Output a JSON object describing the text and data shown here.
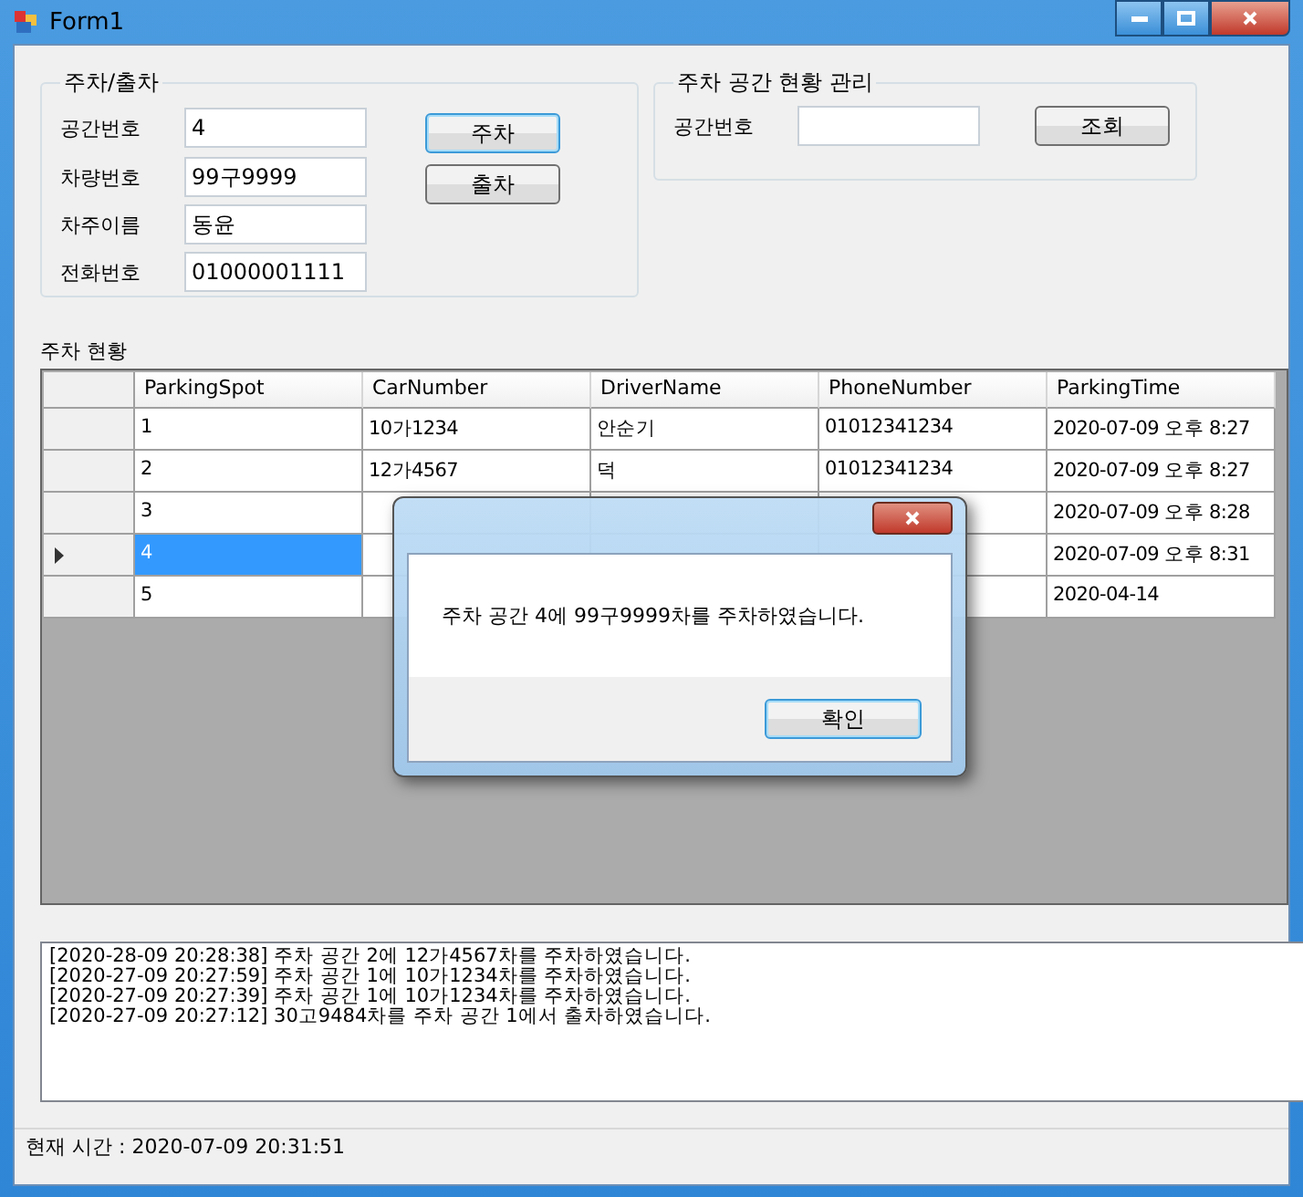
{
  "window": {
    "title": "Form1"
  },
  "parking_group": {
    "title": "주차/출차",
    "fields": [
      {
        "label": "공간번호",
        "value": "4"
      },
      {
        "label": "차량번호",
        "value": "99구9999"
      },
      {
        "label": "차주이름",
        "value": "동윤"
      },
      {
        "label": "전화번호",
        "value": "01000001111"
      }
    ],
    "buttons": [
      {
        "label": "주차",
        "focused": true
      },
      {
        "label": "출차",
        "focused": false
      }
    ]
  },
  "status_group": {
    "title": "주차 공간 현황 관리",
    "field": {
      "label": "공간번호"
    },
    "button": "조회"
  },
  "grid": {
    "title": "주차 현황",
    "columns": [
      "ParkingSpot",
      "CarNumber",
      "DriverName",
      "PhoneNumber",
      "ParkingTime"
    ],
    "rows": [
      {
        "selected": false,
        "cells": [
          "1",
          "10가1234",
          "안순기",
          "01012341234",
          "2020-07-09 오후 8:27"
        ]
      },
      {
        "selected": false,
        "cells": [
          "2",
          "12가4567",
          "덕",
          "01012341234",
          "2020-07-09 오후 8:27"
        ]
      },
      {
        "selected": false,
        "cells": [
          "3",
          null,
          null,
          null,
          "2020-07-09 오후 8:28"
        ]
      },
      {
        "selected": true,
        "cells": [
          "4",
          null,
          null,
          null,
          "2020-07-09 오후 8:31"
        ]
      },
      {
        "selected": false,
        "cells": [
          "5",
          null,
          null,
          null,
          "2020-04-14"
        ]
      }
    ]
  },
  "log": [
    "[2020-28-09 20:28:38] 주차 공간 2에 12가4567차를 주차하였습니다.",
    "[2020-27-09 20:27:59] 주차 공간 1에 10가1234차를 주차하였습니다.",
    "[2020-27-09 20:27:39] 주차 공간 1에 10가1234차를 주차하였습니다.",
    "[2020-27-09 20:27:12] 30고9484차를 주차 공간 1에서 출차하였습니다."
  ],
  "status_bar": "현재 시간 : 2020-07-09 20:31:51",
  "dialog": {
    "message": "주차 공간 4에 99구9999차를 주차하였습니다.",
    "button": "확인"
  }
}
